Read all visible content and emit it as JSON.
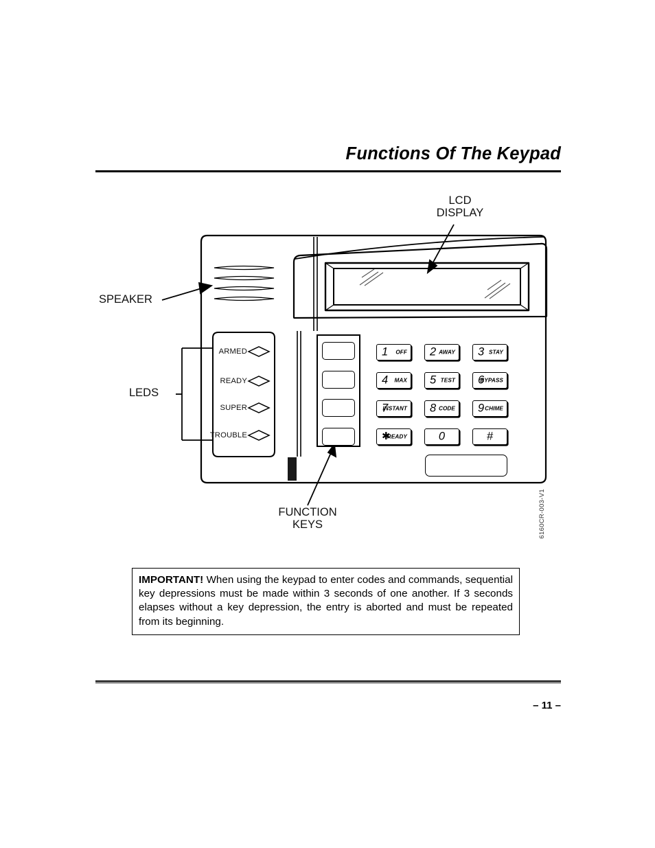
{
  "document": {
    "title": "Functions Of The Keypad",
    "page_number": "– 11 –",
    "part_number": "6160CR-003-V1"
  },
  "callouts": {
    "lcd_display": "LCD\nDISPLAY",
    "speaker": "SPEAKER",
    "leds": "LEDS",
    "function_keys": "FUNCTION\nKEYS"
  },
  "keypad": {
    "leds": [
      {
        "label": "ARMED"
      },
      {
        "label": "READY"
      },
      {
        "label": "SUPER"
      },
      {
        "label": "TROUBLE"
      }
    ],
    "function_keys": [
      {
        "label": ""
      },
      {
        "label": ""
      },
      {
        "label": ""
      },
      {
        "label": ""
      }
    ],
    "keys": [
      {
        "digit": "1",
        "sub": "OFF"
      },
      {
        "digit": "2",
        "sub": "AWAY"
      },
      {
        "digit": "3",
        "sub": "STAY"
      },
      {
        "digit": "4",
        "sub": "MAX"
      },
      {
        "digit": "5",
        "sub": "TEST"
      },
      {
        "digit": "6",
        "sub": "BYPASS"
      },
      {
        "digit": "7",
        "sub": "INSTANT"
      },
      {
        "digit": "8",
        "sub": "CODE"
      },
      {
        "digit": "9",
        "sub": "CHIME"
      },
      {
        "digit": "✱",
        "sub": "READY"
      },
      {
        "digit": "0",
        "sub": ""
      },
      {
        "digit": "#",
        "sub": ""
      }
    ],
    "wide_key": {
      "label": ""
    },
    "lcd_display": {
      "text": ""
    }
  },
  "note": {
    "lead": "IMPORTANT!",
    "body": "When using the keypad to enter codes and commands, sequential key depressions must be made within 3 seconds of one another. If 3 seconds elapses without a key depression, the entry is aborted and must be repeated from its beginning."
  }
}
